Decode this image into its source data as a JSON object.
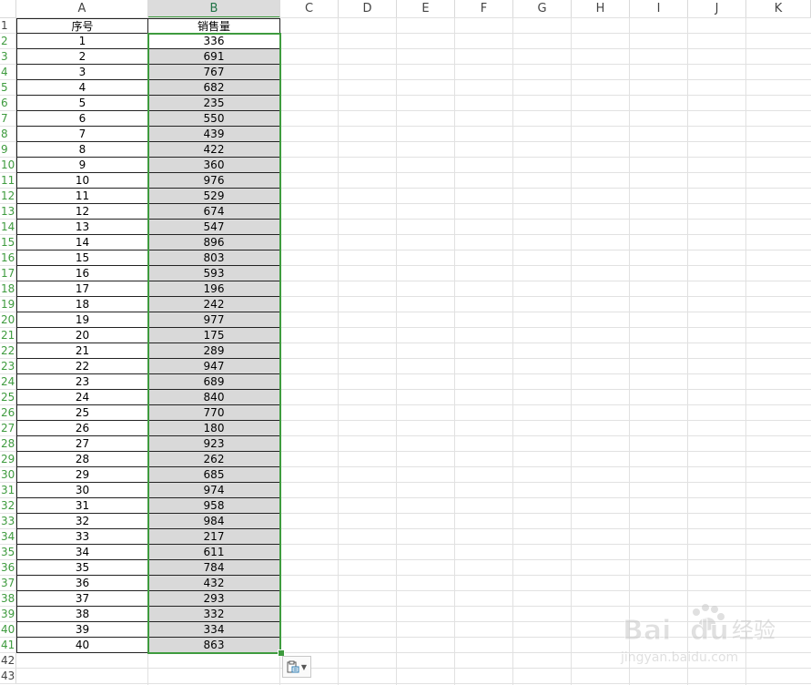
{
  "columns": [
    "A",
    "B",
    "C",
    "D",
    "E",
    "F",
    "G",
    "H",
    "I",
    "J",
    "K"
  ],
  "selected_column": "B",
  "header_row": {
    "a": "序号",
    "b": "销售量"
  },
  "rows": [
    [
      "1",
      "336"
    ],
    [
      "2",
      "691"
    ],
    [
      "3",
      "767"
    ],
    [
      "4",
      "682"
    ],
    [
      "5",
      "235"
    ],
    [
      "6",
      "550"
    ],
    [
      "7",
      "439"
    ],
    [
      "8",
      "422"
    ],
    [
      "9",
      "360"
    ],
    [
      "10",
      "976"
    ],
    [
      "11",
      "529"
    ],
    [
      "12",
      "674"
    ],
    [
      "13",
      "547"
    ],
    [
      "14",
      "896"
    ],
    [
      "15",
      "803"
    ],
    [
      "16",
      "593"
    ],
    [
      "17",
      "196"
    ],
    [
      "18",
      "242"
    ],
    [
      "19",
      "977"
    ],
    [
      "20",
      "175"
    ],
    [
      "21",
      "289"
    ],
    [
      "22",
      "947"
    ],
    [
      "23",
      "689"
    ],
    [
      "24",
      "840"
    ],
    [
      "25",
      "770"
    ],
    [
      "26",
      "180"
    ],
    [
      "27",
      "923"
    ],
    [
      "28",
      "262"
    ],
    [
      "29",
      "685"
    ],
    [
      "30",
      "974"
    ],
    [
      "31",
      "958"
    ],
    [
      "32",
      "984"
    ],
    [
      "33",
      "217"
    ],
    [
      "34",
      "611"
    ],
    [
      "35",
      "784"
    ],
    [
      "36",
      "432"
    ],
    [
      "37",
      "293"
    ],
    [
      "38",
      "332"
    ],
    [
      "39",
      "334"
    ],
    [
      "40",
      "863"
    ]
  ],
  "row_numbers": [
    "1",
    "2",
    "3",
    "4",
    "5",
    "6",
    "7",
    "8",
    "9",
    "10",
    "11",
    "12",
    "13",
    "14",
    "15",
    "16",
    "17",
    "18",
    "19",
    "20",
    "21",
    "22",
    "23",
    "24",
    "25",
    "26",
    "27",
    "28",
    "29",
    "30",
    "31",
    "32",
    "33",
    "34",
    "35",
    "36",
    "37",
    "38",
    "39",
    "40",
    "41",
    "42",
    "43"
  ],
  "paste_options": {
    "icon": "paste-options-icon"
  },
  "watermark": {
    "logo_text": "Bai du 经验",
    "url": "jingyan.baidu.com"
  },
  "colors": {
    "selection": "#3e9b3e",
    "shade": "#d9d9d9",
    "grid": "#e1e1e1"
  }
}
